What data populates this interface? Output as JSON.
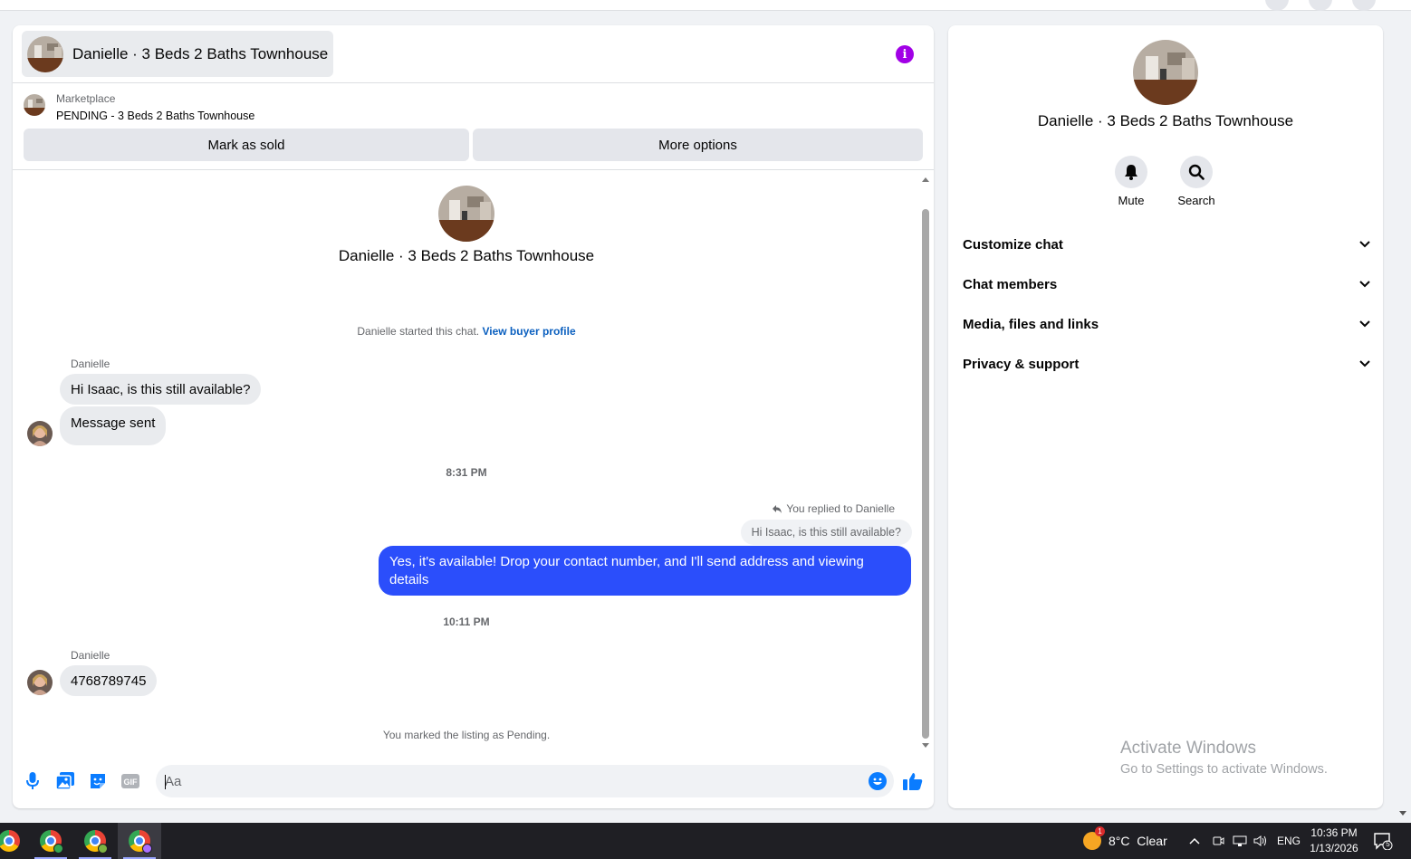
{
  "conversation": {
    "title": "Danielle · 3 Beds 2 Baths Townhouse",
    "info_icon": "info-icon"
  },
  "listing": {
    "source": "Marketplace",
    "status_text": "PENDING - 3 Beds 2 Baths Townhouse",
    "mark_sold_label": "Mark as sold",
    "more_options_label": "More options"
  },
  "thread": {
    "intro_title": "Danielle · 3 Beds 2 Baths Townhouse",
    "started_text": "Danielle started this chat.",
    "view_profile_link": "View buyer profile",
    "group1": {
      "sender": "Danielle",
      "messages": [
        "Hi Isaac, is this still available?",
        "Message sent"
      ]
    },
    "time1": "8:31 PM",
    "reply": {
      "note": "You replied to Danielle",
      "quoted": "Hi Isaac, is this still available?",
      "message": "Yes, it's available! Drop your contact number, and I'll send address and viewing details"
    },
    "time2": "10:11 PM",
    "group2": {
      "sender": "Danielle",
      "messages": [
        "4768789745"
      ]
    },
    "pending_note": "You marked the listing as Pending."
  },
  "composer": {
    "placeholder": "Aa",
    "icons": [
      "microphone-icon",
      "photo-icon",
      "sticker-icon",
      "gif-icon",
      "emoji-icon",
      "thumbs-up-icon"
    ]
  },
  "info_panel": {
    "title": "Danielle · 3 Beds 2 Baths Townhouse",
    "actions": [
      {
        "label": "Mute",
        "icon": "bell-icon"
      },
      {
        "label": "Search",
        "icon": "search-icon"
      }
    ],
    "sections": [
      {
        "label": "Customize chat"
      },
      {
        "label": "Chat members"
      },
      {
        "label": "Media, files and links"
      },
      {
        "label": "Privacy & support"
      }
    ]
  },
  "watermark": {
    "line1": "Activate Windows",
    "line2": "Go to Settings to activate Windows."
  },
  "taskbar": {
    "weather_badge": "1",
    "weather": "8°C  Clear",
    "language": "ENG",
    "time": "10:36 PM",
    "date": "1/13/2026",
    "notification_count": "5"
  },
  "colors": {
    "outgoing_bubble": "#2b4efb",
    "info_icon": "#a100e6",
    "accent_blue": "#0a7cff",
    "link": "#0a5fbf"
  }
}
